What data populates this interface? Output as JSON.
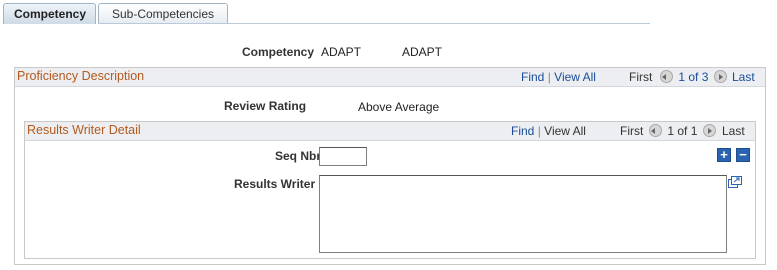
{
  "tabs": [
    {
      "label": "Competency",
      "active": true
    },
    {
      "label": "Sub-Competencies",
      "active": false
    }
  ],
  "competency": {
    "label": "Competency",
    "code": "ADAPT",
    "description": "ADAPT"
  },
  "proficiency": {
    "title": "Proficiency Description",
    "find": "Find",
    "view_all": "View All",
    "first": "First",
    "page": "1 of 3",
    "last": "Last",
    "review_rating_label": "Review Rating",
    "review_rating_value": "Above Average"
  },
  "results_writer_detail": {
    "title": "Results Writer Detail",
    "find": "Find",
    "view_all": "View All",
    "first": "First",
    "page": "1 of 1",
    "last": "Last",
    "seq_nbr_label": "Seq Nbr",
    "seq_nbr_value": "",
    "results_writer_label": "Results Writer",
    "results_writer_value": "",
    "add_icon": "plus-icon",
    "delete_icon": "minus-icon",
    "expand_icon": "popup-expand-icon"
  },
  "colors": {
    "section_title": "#b45a1e",
    "link": "#1a4d99",
    "header_bg": "#eceef1"
  }
}
